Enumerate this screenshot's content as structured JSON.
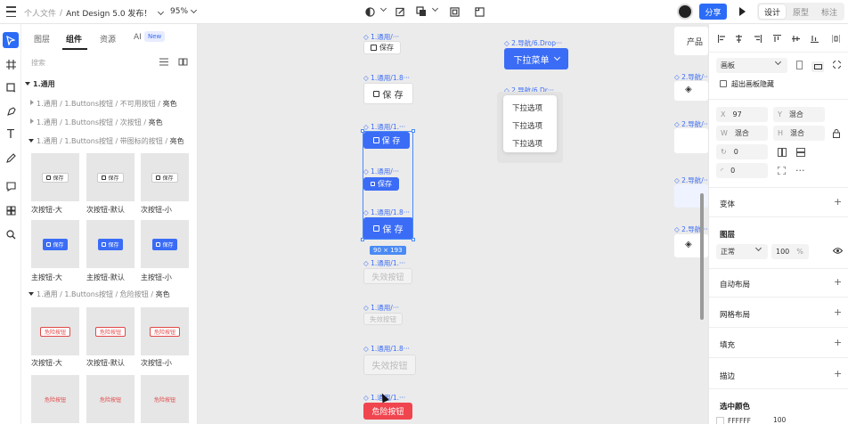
{
  "topbar": {
    "breadcrumb_root": "个人文件",
    "breadcrumb_sep": "/",
    "breadcrumb_current": "Ant Design 5.0 发布！",
    "zoom": "95%",
    "share_label": "分享",
    "mode_tabs": [
      "设计",
      "原型",
      "标注"
    ],
    "active_mode": "设计"
  },
  "left_panel": {
    "tabs": [
      "图层",
      "组件",
      "资源",
      "AI"
    ],
    "active_tab": "组件",
    "new_badge": "New",
    "search_placeholder": "搜索",
    "section_main": "1.通用",
    "groups": [
      {
        "path": "1.通用 / 1.Buttons按钮 / 不可用按钮 /",
        "theme": "亮色",
        "expanded": false
      },
      {
        "path": "1.通用 / 1.Buttons按钮 / 次按钮 /",
        "theme": "亮色",
        "expanded": false
      },
      {
        "path": "1.通用 / 1.Buttons按钮 / 带图标的按钮 /",
        "theme": "亮色",
        "expanded": true
      },
      {
        "path": "1.通用 / 1.Buttons按钮 / 危险按钮 /",
        "theme": "亮色",
        "expanded": true
      }
    ],
    "thumbs_secondary": [
      {
        "btn": "保存",
        "label": "次按钮-大"
      },
      {
        "btn": "保存",
        "label": "次按钮-默认"
      },
      {
        "btn": "保存",
        "label": "次按钮-小"
      }
    ],
    "thumbs_primary": [
      {
        "btn": "保存",
        "label": "主按钮-大"
      },
      {
        "btn": "保存",
        "label": "主按钮-默认"
      },
      {
        "btn": "保存",
        "label": "主按钮-小"
      }
    ],
    "thumbs_danger_secondary": [
      {
        "btn": "危险按钮",
        "label": "次按钮-大"
      },
      {
        "btn": "危险按钮",
        "label": "次按钮-默认"
      },
      {
        "btn": "危险按钮",
        "label": "次按钮-小"
      }
    ],
    "thumbs_danger_text": [
      {
        "btn": "危险按钮"
      },
      {
        "btn": "危险按钮"
      },
      {
        "btn": "危险按钮"
      }
    ]
  },
  "canvas": {
    "labels": [
      "1.通用/···",
      "1.通用/1.8···",
      "1.通用/1.···",
      "1.通用/···",
      "1.通用/1.8···",
      "1.通用/1.···",
      "1.通用/···",
      "1.通用/1.8···",
      "1.通用/1.···"
    ],
    "btn_save_small": "保存",
    "btn_save_default": "保 存",
    "btn_save_primary": "保 存",
    "btn_save_primary_small": "保存",
    "btn_save_primary_large": "保 存",
    "dim_badge": "90 × 193",
    "btn_disabled": "失效按钮",
    "btn_danger": "危险按钮",
    "dropdown_label_1": "2.导航/6.Drop···",
    "dropdown_btn": "下拉菜单",
    "dropdown_label_2": "2.导航/6.Dr···",
    "dropdown_items": [
      "下拉选项",
      "下拉选项",
      "下拉选项"
    ],
    "right_labels": [
      "2.导航/···",
      "2.导航/···",
      "2.导航/···",
      "2.导航/···"
    ],
    "right_card_text": "产品"
  },
  "right_panel": {
    "frame_type": "画板",
    "hide_overflow": "超出画板隐藏",
    "x_key": "X",
    "x_val": "97",
    "y_key": "Y",
    "y_val": "混合",
    "w_key": "W",
    "w_val": "混合",
    "h_key": "H",
    "h_val": "混合",
    "rotation": "0",
    "radius": "0",
    "variant": "变体",
    "layer": "图层",
    "blend_mode": "正常",
    "opacity": "100",
    "opacity_unit": "%",
    "auto_layout": "自动布局",
    "grid_layout": "网格布局",
    "fill": "填充",
    "stroke": "描边",
    "selected_colors": "选中颜色",
    "color_hex": "FFFFFF",
    "color_opacity": "100"
  },
  "colors": {
    "primary": "#3b6cf6",
    "danger": "#f0454f",
    "selection": "#4a8af4"
  }
}
